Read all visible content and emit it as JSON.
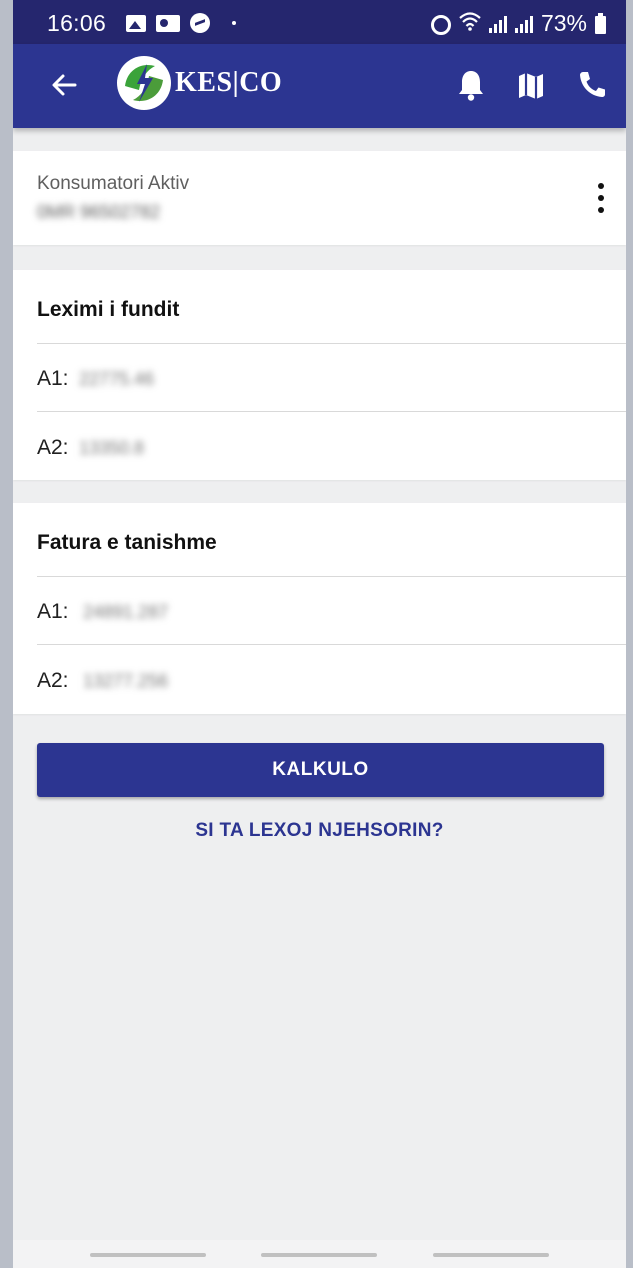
{
  "status_bar": {
    "time": "16:06",
    "battery": "73%"
  },
  "app_bar": {
    "logo_text": "KES|CO",
    "icons": [
      "back-arrow-icon",
      "bell-icon",
      "map-icon",
      "phone-icon"
    ]
  },
  "consumer": {
    "label": "Konsumatori Aktiv",
    "number": "0MR 96502782"
  },
  "last_reading": {
    "title": "Leximi i fundit",
    "rows": [
      {
        "label": "A1:",
        "value": "22775.46"
      },
      {
        "label": "A2:",
        "value": "13350.8"
      }
    ]
  },
  "current_invoice": {
    "title": "Fatura e tanishme",
    "rows": [
      {
        "label": "A1:",
        "value": "24891.287"
      },
      {
        "label": "A2:",
        "value": "13277.256"
      }
    ]
  },
  "actions": {
    "calculate": "KALKULO",
    "help_link": "SI TA LEXOJ NJEHSORIN?"
  },
  "colors": {
    "primary": "#2c3591",
    "status_bar": "#25266e",
    "background": "#eeeff0"
  }
}
